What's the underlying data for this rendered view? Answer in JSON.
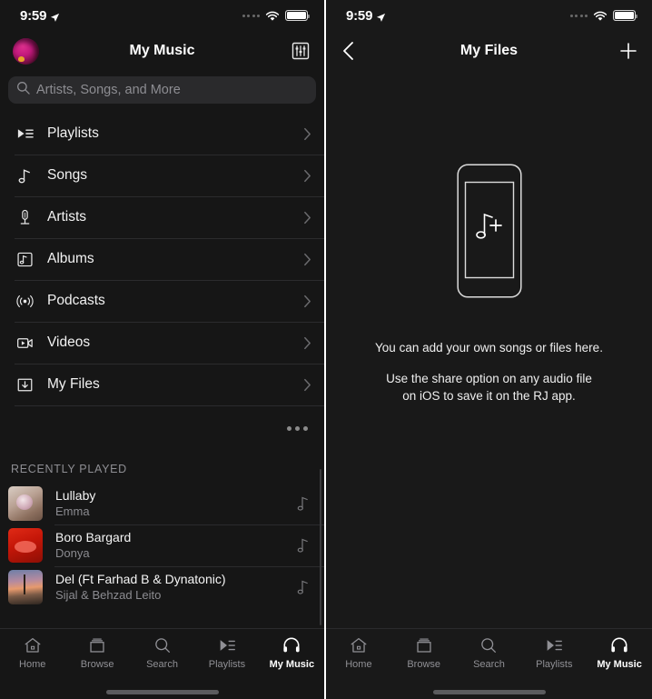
{
  "status_bar": {
    "time": "9:59",
    "location_icon": "location-arrow-icon",
    "signal_icon": "signal-dots-icon",
    "wifi_icon": "wifi-icon",
    "battery_icon": "battery-full-icon"
  },
  "colors": {
    "background": "#161616",
    "background_right": "#191919",
    "separator": "#2b2b2d",
    "text_primary": "#f2f2f2",
    "text_secondary": "#8e8e93",
    "search_field": "#2a2a2c",
    "accent_avatar": "#c2197c"
  },
  "left_panel": {
    "nav": {
      "title": "My Music",
      "avatar_name": "user-avatar",
      "equalizer_label": "equalizer-icon"
    },
    "search": {
      "placeholder": "Artists, Songs, and More",
      "value": "",
      "icon": "search-icon"
    },
    "menu": [
      {
        "label": "Playlists",
        "icon": "playlist-icon"
      },
      {
        "label": "Songs",
        "icon": "music-note-icon"
      },
      {
        "label": "Artists",
        "icon": "microphone-icon"
      },
      {
        "label": "Albums",
        "icon": "album-icon"
      },
      {
        "label": "Podcasts",
        "icon": "podcast-icon"
      },
      {
        "label": "Videos",
        "icon": "video-icon"
      },
      {
        "label": "My Files",
        "icon": "download-box-icon"
      }
    ],
    "more_button": "more-options-icon",
    "recently_played": {
      "header": "RECENTLY PLAYED",
      "items": [
        {
          "title": "Lullaby",
          "artist": "Emma",
          "art": "a1"
        },
        {
          "title": "Boro Bargard",
          "artist": "Donya",
          "art": "a2"
        },
        {
          "title": "Del (Ft Farhad B & Dynatonic)",
          "artist": "Sijal & Behzad Leito",
          "art": "a3"
        }
      ]
    }
  },
  "right_panel": {
    "nav": {
      "title": "My Files",
      "back_label": "back-chevron-icon",
      "add_label": "plus-icon"
    },
    "empty_state": {
      "illustration": "phone-with-add-music-icon",
      "line1": "You can add your own songs or files here.",
      "line2": "Use the share option on any audio file on iOS to save it on the RJ app."
    }
  },
  "tab_bar": {
    "items": [
      {
        "label": "Home",
        "icon": "home-icon",
        "active": false
      },
      {
        "label": "Browse",
        "icon": "browse-icon",
        "active": false
      },
      {
        "label": "Search",
        "icon": "search-icon",
        "active": false
      },
      {
        "label": "Playlists",
        "icon": "playlist-icon",
        "active": false
      },
      {
        "label": "My Music",
        "icon": "headphones-icon",
        "active": true
      }
    ]
  }
}
